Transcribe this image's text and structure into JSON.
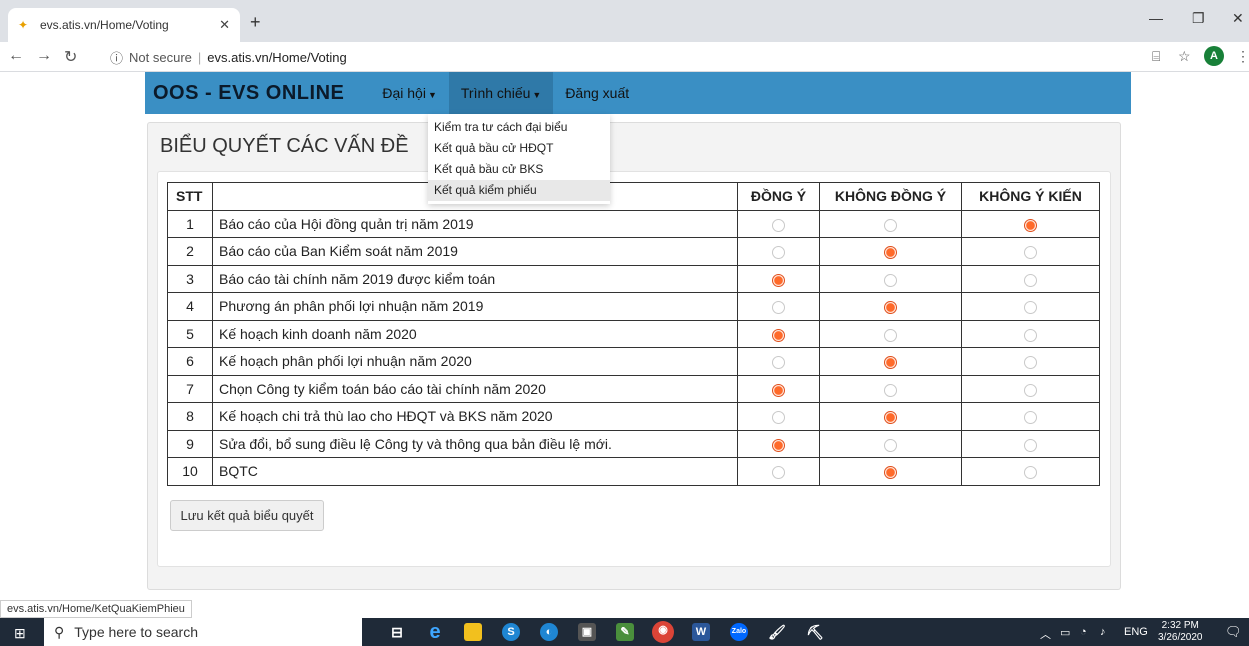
{
  "browser": {
    "tab_title": "evs.atis.vn/Home/Voting",
    "new_tab": "+",
    "security_label": "Not secure",
    "url": "evs.atis.vn/Home/Voting",
    "avatar_letter": "A",
    "status_url": "evs.atis.vn/Home/KetQuaKiemPhieu"
  },
  "navbar": {
    "brand": "OOS - EVS ONLINE",
    "items": [
      {
        "label": "Đại hội"
      },
      {
        "label": "Trình chiếu"
      },
      {
        "label": "Đăng xuất"
      }
    ]
  },
  "dropdown": {
    "items": [
      {
        "label": "Kiểm tra tư cách đại biểu"
      },
      {
        "label": "Kết quả bầu cử HĐQT"
      },
      {
        "label": "Kết quả bầu cử BKS"
      },
      {
        "label": "Kết quả kiểm phiếu"
      }
    ]
  },
  "panel": {
    "title": "BIỂU QUYẾT CÁC VẤN ĐỀ",
    "save_label": "Lưu kết quả biểu quyết"
  },
  "table": {
    "headers": {
      "stt": "STT",
      "content": "",
      "agree": "ĐỒNG Ý",
      "disagree": "KHÔNG ĐỒNG Ý",
      "no_opinion": "KHÔNG Ý KIẾN"
    },
    "rows": [
      {
        "stt": "1",
        "content": "Báo cáo của Hội đồng quản trị năm 2019",
        "choice": "no_opinion"
      },
      {
        "stt": "2",
        "content": "Báo cáo của Ban Kiểm soát năm 2019",
        "choice": "disagree"
      },
      {
        "stt": "3",
        "content": "Báo cáo tài chính năm 2019 được kiểm toán",
        "choice": "agree"
      },
      {
        "stt": "4",
        "content": "Phương án phân phối lợi nhuận năm 2019",
        "choice": "disagree"
      },
      {
        "stt": "5",
        "content": "Kế hoạch kinh doanh năm 2020",
        "choice": "agree"
      },
      {
        "stt": "6",
        "content": "Kế hoạch phân phối lợi nhuận năm 2020",
        "choice": "disagree"
      },
      {
        "stt": "7",
        "content": "Chọn Công ty kiểm toán báo cáo tài chính năm 2020",
        "choice": "agree"
      },
      {
        "stt": "8",
        "content": "Kế hoạch chi trả thù lao cho HĐQT và BKS năm 2020",
        "choice": "disagree"
      },
      {
        "stt": "9",
        "content": "Sửa đổi, bổ sung điều lệ Công ty và thông qua bản điều lệ mới.",
        "choice": "agree"
      },
      {
        "stt": "10",
        "content": "BQTC",
        "choice": "disagree"
      }
    ]
  },
  "taskbar": {
    "search_placeholder": "Type here to search",
    "lang": "ENG",
    "time": "2:32 PM",
    "date": "3/26/2020"
  },
  "colors": {
    "navbar": "#3a8fc4",
    "radio_selected": "#ff6a2a",
    "taskbar": "#1f2a38"
  }
}
